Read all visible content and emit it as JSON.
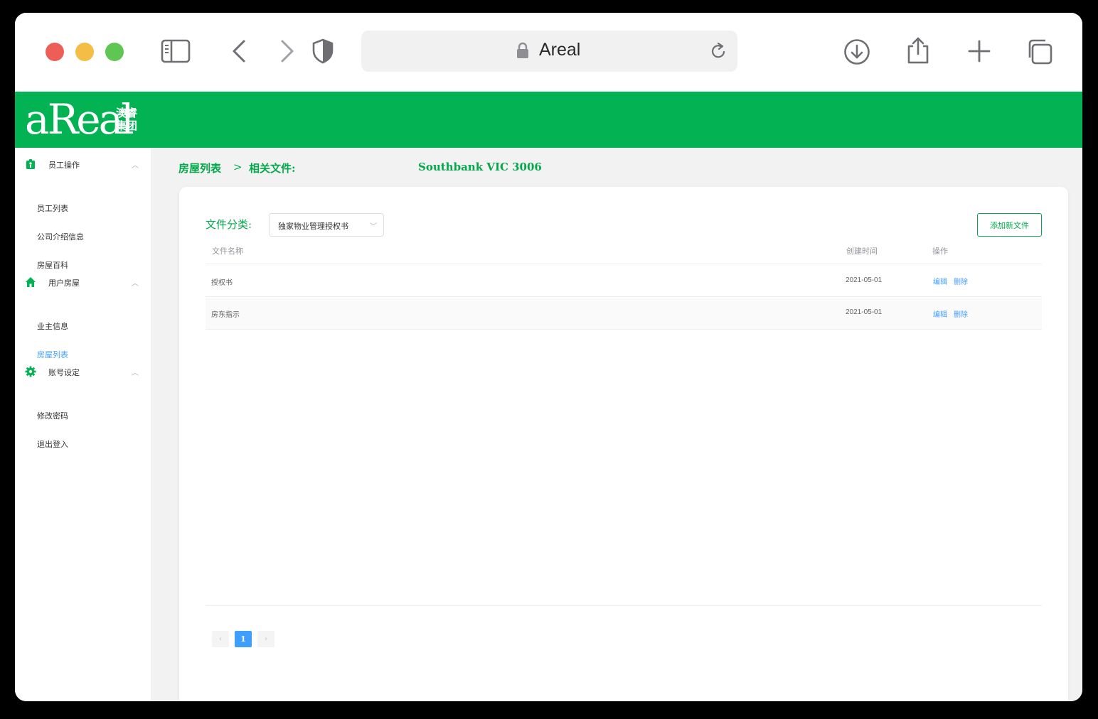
{
  "browser": {
    "address": "Areal"
  },
  "brand": {
    "logo_text": "aReal",
    "logo_cn_line1": "澳睿",
    "logo_cn_line2": "集团",
    "color": "#02b253"
  },
  "sidebar": {
    "groups": [
      {
        "label": "员工操作",
        "icon": "badge-icon",
        "items": [
          {
            "label": "员工列表"
          },
          {
            "label": "公司介绍信息"
          },
          {
            "label": "房屋百科"
          }
        ]
      },
      {
        "label": "用户房屋",
        "icon": "home-icon",
        "items": [
          {
            "label": "业主信息"
          },
          {
            "label": "房屋列表",
            "active": true
          }
        ]
      },
      {
        "label": "账号设定",
        "icon": "gear-icon",
        "items": [
          {
            "label": "修改密码"
          },
          {
            "label": "退出登入"
          }
        ]
      }
    ]
  },
  "breadcrumb": {
    "home": "房屋列表",
    "separator": ">",
    "current": "相关文件:",
    "address": "Southbank VIC 3006"
  },
  "filter": {
    "label": "文件分类:",
    "selected": "独家物业管理授权书"
  },
  "toolbar": {
    "add_label": "添加新文件"
  },
  "table": {
    "columns": [
      "文件名称",
      "创建时间",
      "操作"
    ],
    "rows": [
      {
        "name": "授权书",
        "date": "2021-05-01",
        "edit": "编辑",
        "delete": "删除"
      },
      {
        "name": "房东指示",
        "date": "2021-05-01",
        "edit": "编辑",
        "delete": "删除"
      }
    ]
  },
  "pagination": {
    "current_page": "1",
    "prev": "‹",
    "next": "›"
  }
}
